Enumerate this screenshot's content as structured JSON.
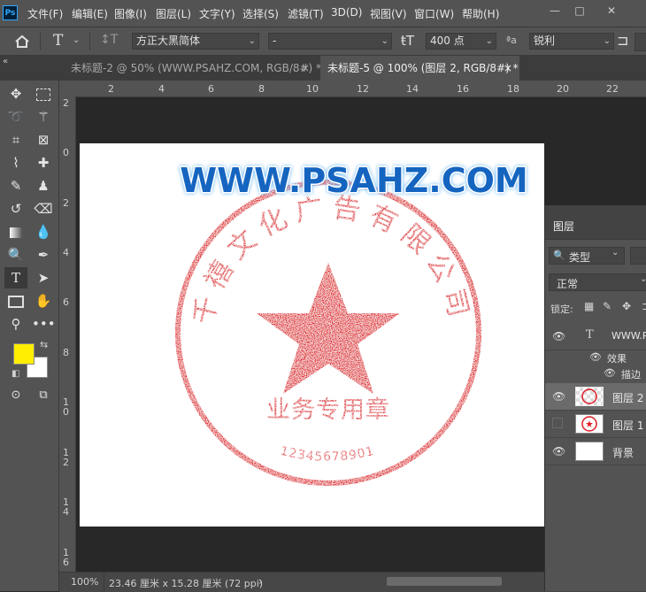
{
  "app": {
    "logo": "Ps"
  },
  "menu": [
    "文件(F)",
    "编辑(E)",
    "图像(I)",
    "图层(L)",
    "文字(Y)",
    "选择(S)",
    "滤镜(T)",
    "3D(D)",
    "视图(V)",
    "窗口(W)",
    "帮助(H)"
  ],
  "window_controls": {
    "minimize": "—",
    "maximize": "□",
    "close": "✕"
  },
  "options_bar": {
    "font_family": "方正大黑简体",
    "font_style": "-",
    "font_size": "400 点",
    "aa_label": "ªa",
    "antialias": "锐利"
  },
  "tabs": [
    {
      "label": "未标题-2 @ 50% (WWW.PSAHZ.COM, RGB/8#) *",
      "close": "×",
      "active": false
    },
    {
      "label": "未标题-5 @ 100% (图层 2, RGB/8#) *",
      "close": "×",
      "active": true
    }
  ],
  "ruler": {
    "h_ticks": [
      "2",
      "4",
      "6",
      "8",
      "10",
      "12",
      "14",
      "16",
      "18",
      "20",
      "22"
    ],
    "v_ticks": [
      "2",
      "0",
      "2",
      "4",
      "6",
      "8",
      "1 0",
      "1 2",
      "1 4",
      "1 6"
    ]
  },
  "canvas": {
    "heading": "WWW.PSAHZ.COM",
    "seal_arc_text": "千禧文化广告有限公司",
    "seal_center_text": "业务专用章",
    "seal_number": "12345678901",
    "colors": {
      "seal": "#e01b24",
      "heading_fill": "#1565c0",
      "heading_outline": "#ffffff",
      "heading_glow": "#64b5f6"
    }
  },
  "colors": {
    "foreground": "#ffee00",
    "background": "#ffffff"
  },
  "status": {
    "zoom": "100%",
    "doc_size": "23.46 厘米 x 15.28 厘米 (72 ppi)",
    "arrow": "›"
  },
  "layers_panel": {
    "title": "图层",
    "filter_kind": "类型",
    "blend_mode": "正常",
    "lock_label": "锁定:",
    "layers": [
      {
        "name": "WWW.P",
        "kind": "text",
        "visible": true
      },
      {
        "name": "效果",
        "kind": "effects",
        "visible": true
      },
      {
        "name": "描边",
        "kind": "effect",
        "visible": true
      },
      {
        "name": "图层 2",
        "kind": "pixel",
        "visible": true,
        "selected": true
      },
      {
        "name": "图层 1",
        "kind": "pixel",
        "visible": false
      },
      {
        "name": "背景",
        "kind": "background",
        "visible": true
      }
    ]
  }
}
